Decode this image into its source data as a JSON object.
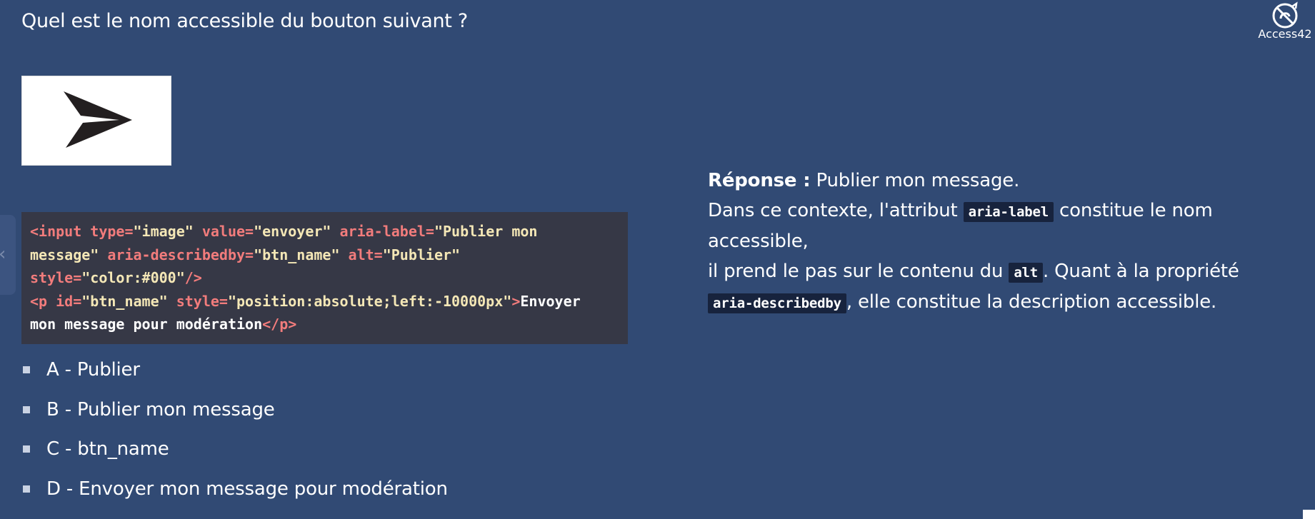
{
  "question": "Quel est le nom accessible du bouton suivant ?",
  "logo": {
    "name": "Access42",
    "icon": "access42-logo-icon"
  },
  "image": {
    "icon": "send-arrow-icon"
  },
  "code_lines": [
    [
      {
        "c": "tag",
        "t": "<input "
      },
      {
        "c": "attr",
        "t": "type="
      },
      {
        "c": "val",
        "t": "\"image\" "
      },
      {
        "c": "attr",
        "t": "value="
      },
      {
        "c": "val",
        "t": "\"envoyer\" "
      },
      {
        "c": "attr",
        "t": "aria-label="
      },
      {
        "c": "val",
        "t": "\"Publier mon"
      }
    ],
    [
      {
        "c": "val",
        "t": "message\" "
      },
      {
        "c": "attr",
        "t": "aria-describedby="
      },
      {
        "c": "val",
        "t": "\"btn_name\" "
      },
      {
        "c": "attr",
        "t": "alt="
      },
      {
        "c": "val",
        "t": "\"Publier\""
      }
    ],
    [
      {
        "c": "attr",
        "t": "style="
      },
      {
        "c": "val",
        "t": "\"color:#000\""
      },
      {
        "c": "tag",
        "t": "/>"
      }
    ],
    [
      {
        "c": "tag",
        "t": "<p "
      },
      {
        "c": "attr",
        "t": "id="
      },
      {
        "c": "val",
        "t": "\"btn_name\" "
      },
      {
        "c": "attr",
        "t": "style="
      },
      {
        "c": "val",
        "t": "\"position:absolute;left:-10000px\""
      },
      {
        "c": "tag",
        "t": ">"
      },
      {
        "c": "txt",
        "t": "Envoyer"
      }
    ],
    [
      {
        "c": "txt",
        "t": "mon message pour modération"
      },
      {
        "c": "tag",
        "t": "</p>"
      }
    ]
  ],
  "options": [
    "A - Publier",
    "B - Publier mon message",
    "C - btn_name",
    "D - Envoyer mon message pour modération"
  ],
  "answer": {
    "label": "Réponse :",
    "value": " Publier mon message.",
    "p1": "Dans ce contexte, l'attribut ",
    "code1": "aria-label",
    "p2": " constitue le nom accessible,",
    "p3": "il prend le pas sur le contenu du ",
    "code2": "alt",
    "p4": ". Quant à la propriété",
    "code3": "aria-describedby",
    "p5": ", elle constitue la description accessible."
  },
  "colors": {
    "background": "#314a74",
    "code_background": "#363846",
    "code_tag": "#f27c7c",
    "code_value": "#f4e7b6",
    "inline_code_background": "#17233d"
  }
}
